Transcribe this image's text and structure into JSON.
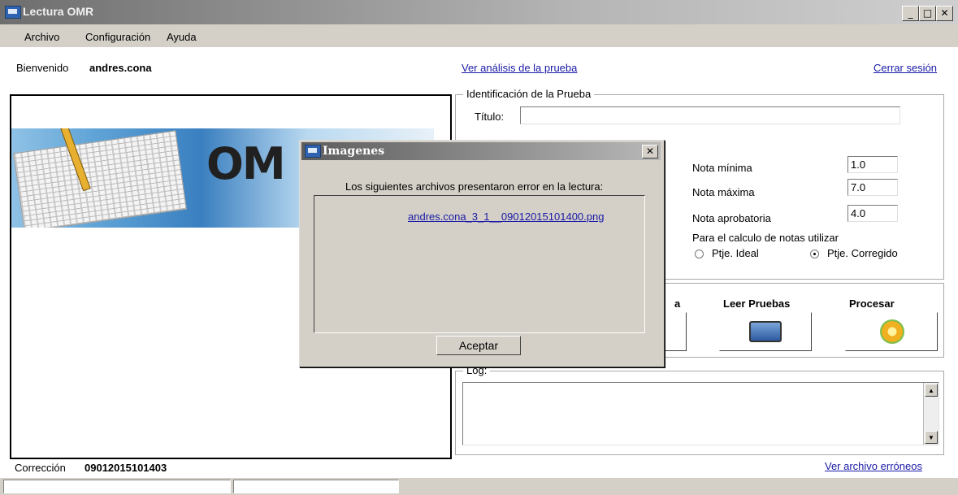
{
  "window": {
    "title": "Lectura OMR",
    "min_label": "_",
    "max_label": "□",
    "close_label": "✕"
  },
  "menu": {
    "items": [
      "Archivo",
      "Configuración",
      "Ayuda"
    ]
  },
  "header": {
    "welcome_label": "Bienvenido",
    "username": "andres.cona",
    "analysis_link": "Ver análisis de la prueba",
    "logout_link": "Cerrar sesión"
  },
  "image_panel": {
    "banner_text": "OM"
  },
  "identification": {
    "legend": "Identificación de la Prueba",
    "title_label": "Título:",
    "title_value": ""
  },
  "grades": {
    "min_label": "Nota mínima",
    "min_value": "1.0",
    "max_label": "Nota máxima",
    "max_value": "7.0",
    "pass_label": "Nota aprobatoria",
    "pass_value": "4.0",
    "calc_label": "Para el calculo de notas utilizar",
    "option_ideal": "Ptje. Ideal",
    "option_corrected": "Ptje. Corregido",
    "selected": "Ptje. Corregido"
  },
  "actions": {
    "partial_label": "a",
    "read_label": "Leer Pruebas",
    "process_label": "Procesar"
  },
  "log": {
    "legend": "Log:",
    "value": ""
  },
  "footer": {
    "correction_label": "Corrección",
    "correction_value": "09012015101403",
    "error_files_link": "Ver archivo erróneos"
  },
  "dialog": {
    "title": "Imagenes",
    "message": "Los siguientes archivos presentaron error en la lectura:",
    "files": [
      "andres.cona_3_1__09012015101400.png"
    ],
    "ok_label": "Aceptar"
  },
  "colors": {
    "link": "#1a1aa6",
    "title_bar": "#6e6e6e",
    "background": "#d4d0c8"
  }
}
